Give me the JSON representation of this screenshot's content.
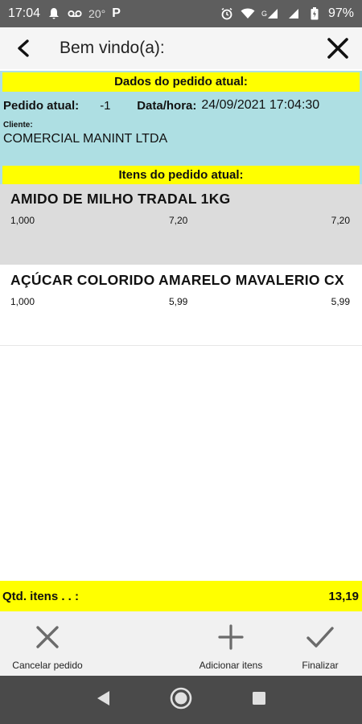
{
  "status_bar": {
    "time": "17:04",
    "temperature": "20°",
    "app_badge": "P",
    "battery": "97%",
    "signal_label": "G"
  },
  "app_bar": {
    "title": "Bem vindo(a):"
  },
  "order": {
    "section_title": "Dados do pedido atual:",
    "order_label": "Pedido atual:",
    "order_value": "-1",
    "datetime_label": "Data/hora:",
    "datetime_value": "24/09/2021 17:04:30",
    "client_label": "Cliente:",
    "client_value": "COMERCIAL MANINT LTDA",
    "items_title": "Itens do pedido atual:"
  },
  "items": [
    {
      "name": "AMIDO DE MILHO TRADAL 1KG",
      "qty": "1,000",
      "price": "7,20",
      "total": "7,20"
    },
    {
      "name": "AÇÚCAR COLORIDO AMARELO MAVALERIO CX",
      "qty": "1,000",
      "price": "5,99",
      "total": "5,99"
    }
  ],
  "summary": {
    "label": "Qtd. itens . . :",
    "value": "13,19"
  },
  "actions": {
    "cancel": "Cancelar pedido",
    "add": "Adicionar itens",
    "finish": "Finalizar"
  },
  "colors": {
    "highlight": "#ffff00",
    "header_bg": "#aedfe3",
    "status_bar": "#5e5e5e",
    "nav_bar": "#4a4a4a"
  }
}
